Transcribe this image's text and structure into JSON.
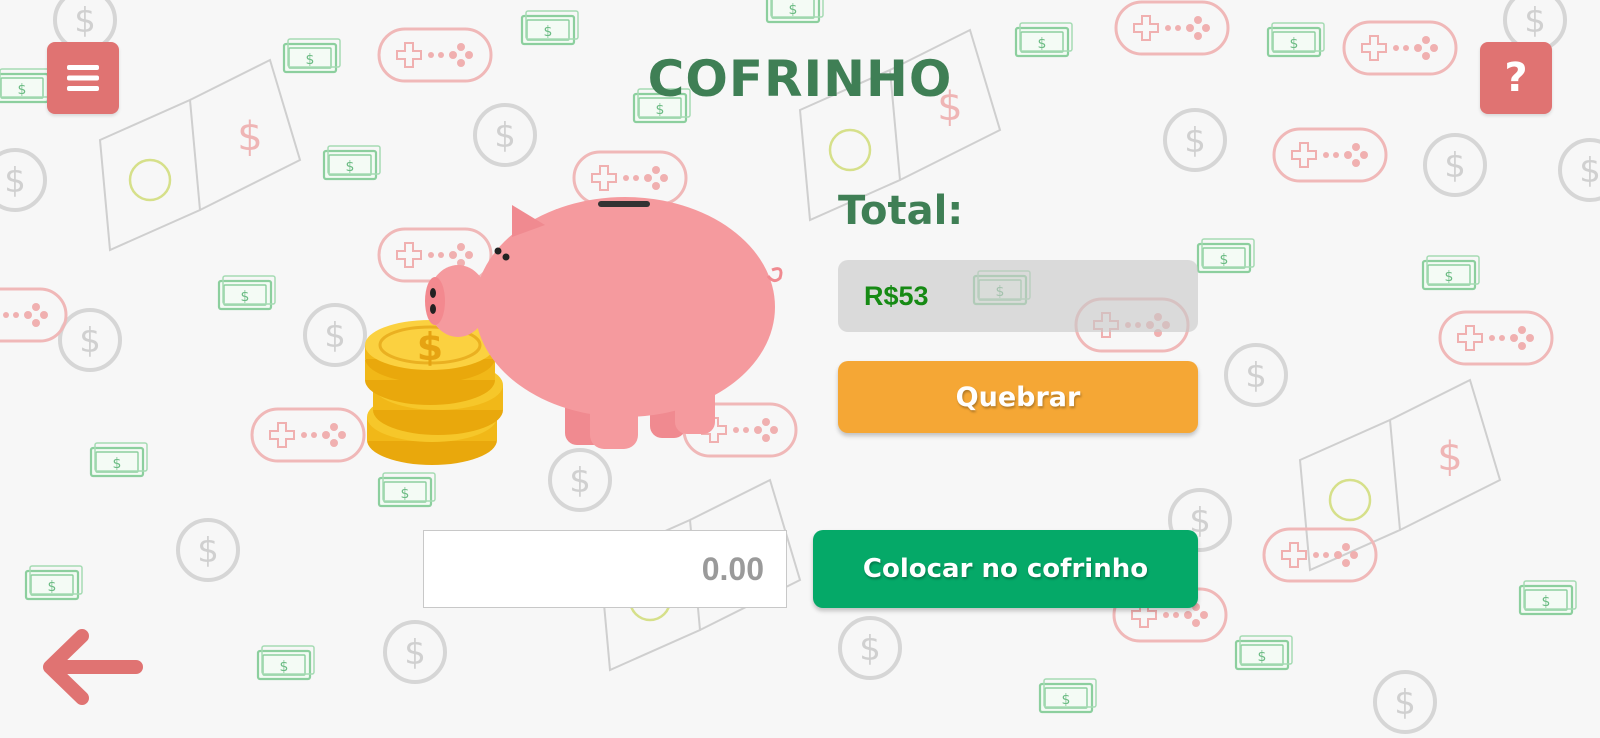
{
  "app": {
    "title": "COFRINHO"
  },
  "header": {
    "menu_icon": "hamburger-menu-icon",
    "help_label": "?"
  },
  "summary": {
    "total_label": "Total:",
    "total_value": "R$53"
  },
  "actions": {
    "break_label": "Quebrar",
    "deposit_label": "Colocar no cofrinho"
  },
  "deposit": {
    "placeholder": "0.00",
    "value": ""
  },
  "navigation": {
    "back_icon": "arrow-left-icon"
  },
  "colors": {
    "title": "#3f7f55",
    "corner_buttons": "#e07372",
    "break_button": "#f5a735",
    "deposit_button": "#05a968",
    "total_value": "#168a14",
    "piggy": "#f59a9e",
    "coins": "#f4c020"
  }
}
